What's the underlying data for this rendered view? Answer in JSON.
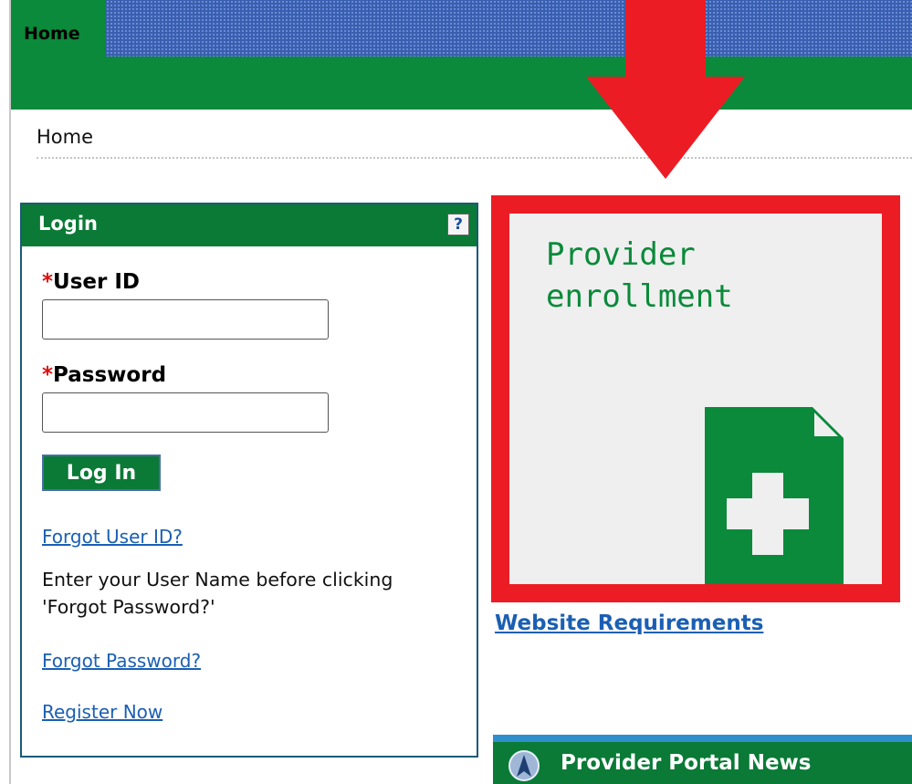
{
  "nav": {
    "home_tab": "Home"
  },
  "breadcrumb": "Home",
  "login": {
    "title": "Login",
    "help_symbol": "?",
    "required_mark": "*",
    "user_id_label": "User ID",
    "user_id_value": "",
    "password_label": "Password",
    "password_value": "",
    "submit_label": "Log In",
    "forgot_user_id": "Forgot User ID?",
    "forgot_hint": "Enter your User Name before clicking 'Forgot Password?'",
    "forgot_password": "Forgot Password?",
    "register": "Register Now"
  },
  "promo": {
    "title": "Provider enrollment",
    "icon": "document-plus-icon"
  },
  "website_requirements": "Website Requirements",
  "news": {
    "title": "Provider Portal News",
    "icon": "news-globe-icon"
  },
  "colors": {
    "brand_green": "#0a7a36",
    "nav_blue": "#3b5fb0",
    "highlight_red": "#ec1c24",
    "link_blue": "#1a5fb4"
  }
}
